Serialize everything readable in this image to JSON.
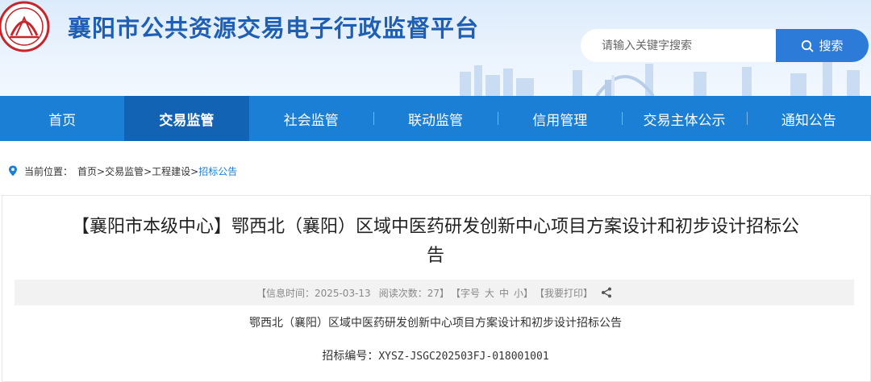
{
  "header": {
    "title": "襄阳市公共资源交易电子行政监督平台",
    "search_placeholder": "请输入关键字搜索",
    "search_button": "搜索",
    "colors": {
      "title": "#1e5fb5",
      "search_button": "#2d7bd9",
      "logo": "#c5252b"
    }
  },
  "nav": {
    "items": [
      {
        "label": "首页"
      },
      {
        "label": "交易监管",
        "active": true
      },
      {
        "label": "社会监管"
      },
      {
        "label": "联动监管"
      },
      {
        "label": "信用管理"
      },
      {
        "label": "交易主体公示"
      },
      {
        "label": "通知公告"
      }
    ],
    "colors": {
      "bar": "#1b7fd6",
      "active": "#1363b4"
    }
  },
  "breadcrumb": {
    "prefix": "当前位置：",
    "items": [
      "首页>",
      "交易监管>",
      "工程建设>",
      "招标公告"
    ]
  },
  "article": {
    "title_line1": "【襄阳市本级中心】鄂西北（襄阳）区域中医药研发创新中心项目方案设计和初步设计招标公",
    "title_line2": "告",
    "info": {
      "time": "【信息时间：2025-03-13",
      "views": "阅读次数：27】",
      "font_size_prefix": "【字号",
      "font_large": "大",
      "font_medium": "中",
      "font_small": "小】",
      "print": "【我要打印】"
    },
    "body_title": "鄂西北（襄阳）区域中医药研发创新中心项目方案设计和初步设计招标公告",
    "code_label": "招标编号：",
    "code_value": "XYSZ-JSGC202503FJ-018001001"
  }
}
